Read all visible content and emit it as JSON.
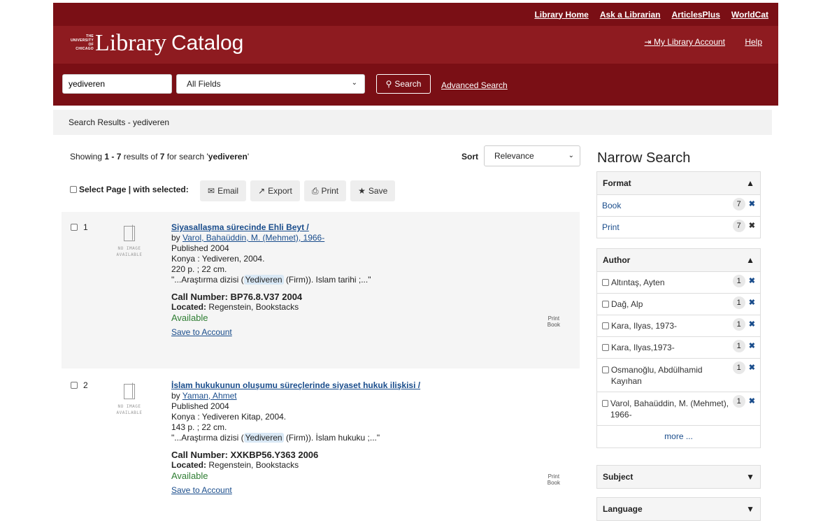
{
  "topnav": [
    "Library Home",
    "Ask a Librarian",
    "ArticlesPlus",
    "WorldCat"
  ],
  "header": {
    "logo_univ": [
      "THE",
      "UNIVERSITY",
      "OF",
      "CHICAGO"
    ],
    "logo_lib": "Library",
    "logo_catalog": "Catalog",
    "account": "My Library Account",
    "help": "Help"
  },
  "search": {
    "query": "yediveren",
    "field": "All Fields",
    "button": "Search",
    "advanced": "Advanced Search"
  },
  "breadcrumb": "Search Results - yediveren",
  "results_header": {
    "showing_prefix": "Showing ",
    "range": "1 - 7",
    "results_of": " results of ",
    "total": "7",
    "for_search": " for search '",
    "term": "yediveren",
    "close_quote": "'",
    "sort_label": "Sort",
    "sort_value": "Relevance"
  },
  "bulk": {
    "select_page": "Select Page | with selected:",
    "email": "Email",
    "export": "Export",
    "print": "Print",
    "save": "Save"
  },
  "noimage": [
    "NO IMAGE",
    "AVAILABLE"
  ],
  "results": [
    {
      "num": "1",
      "title": "Siyasallaşma sürecinde Ehli Beyt /",
      "by": "by ",
      "author": "Varol, Bahaüddin, M. (Mehmet), 1966-",
      "published": "Published 2004",
      "pub_place": "Konya : Yediveren, 2004.",
      "extent": "220 p. ; 22 cm.",
      "snippet_pre": "\"...Araştırma dizisi (",
      "snippet_hl": "Yediveren",
      "snippet_post": " (Firm)). Islam tarihi ;...\"",
      "callno_label": "Call Number: ",
      "callno": "BP76.8.V37 2004",
      "located_label": "Located:",
      "located": " Regenstein, Bookstacks",
      "status": "Available",
      "save": "Save to Account",
      "format_top": "Print",
      "format_bottom": "Book"
    },
    {
      "num": "2",
      "title": "İslam hukukunun oluşumu süreçlerinde siyaset hukuk ilişkisi /",
      "by": "by ",
      "author": "Yaman, Ahmet",
      "published": "Published 2004",
      "pub_place": "Konya : Yediveren Kitap, 2004.",
      "extent": "143 p. ; 22 cm.",
      "snippet_pre": "\"...Araştırma dizisi (",
      "snippet_hl": "Yediveren",
      "snippet_post": " (Firm)). İslam hukuku ;...\"",
      "callno_label": "Call Number: ",
      "callno": "XXKBP56.Y363 2006",
      "located_label": "Located:",
      "located": " Regenstein, Bookstacks",
      "status": "Available",
      "save": "Save to Account",
      "format_top": "Print",
      "format_bottom": "Book"
    }
  ],
  "narrow": {
    "title": "Narrow Search",
    "format": {
      "label": "Format",
      "items": [
        {
          "label": "Book",
          "count": "7"
        },
        {
          "label": "Print",
          "count": "7"
        }
      ]
    },
    "author": {
      "label": "Author",
      "items": [
        {
          "label": "Altıntaş, Ayten",
          "count": "1"
        },
        {
          "label": "Dağ, Alp",
          "count": "1"
        },
        {
          "label": "Kara, Ilyas, 1973-",
          "count": "1"
        },
        {
          "label": "Kara, Ilyas,1973-",
          "count": "1"
        },
        {
          "label": "Osmanoğlu, Abdülhamid Kayıhan",
          "count": "1"
        },
        {
          "label": "Varol, Bahaüddin, M. (Mehmet), 1966-",
          "count": "1"
        }
      ],
      "more": "more ..."
    },
    "subject": "Subject",
    "language": "Language"
  }
}
